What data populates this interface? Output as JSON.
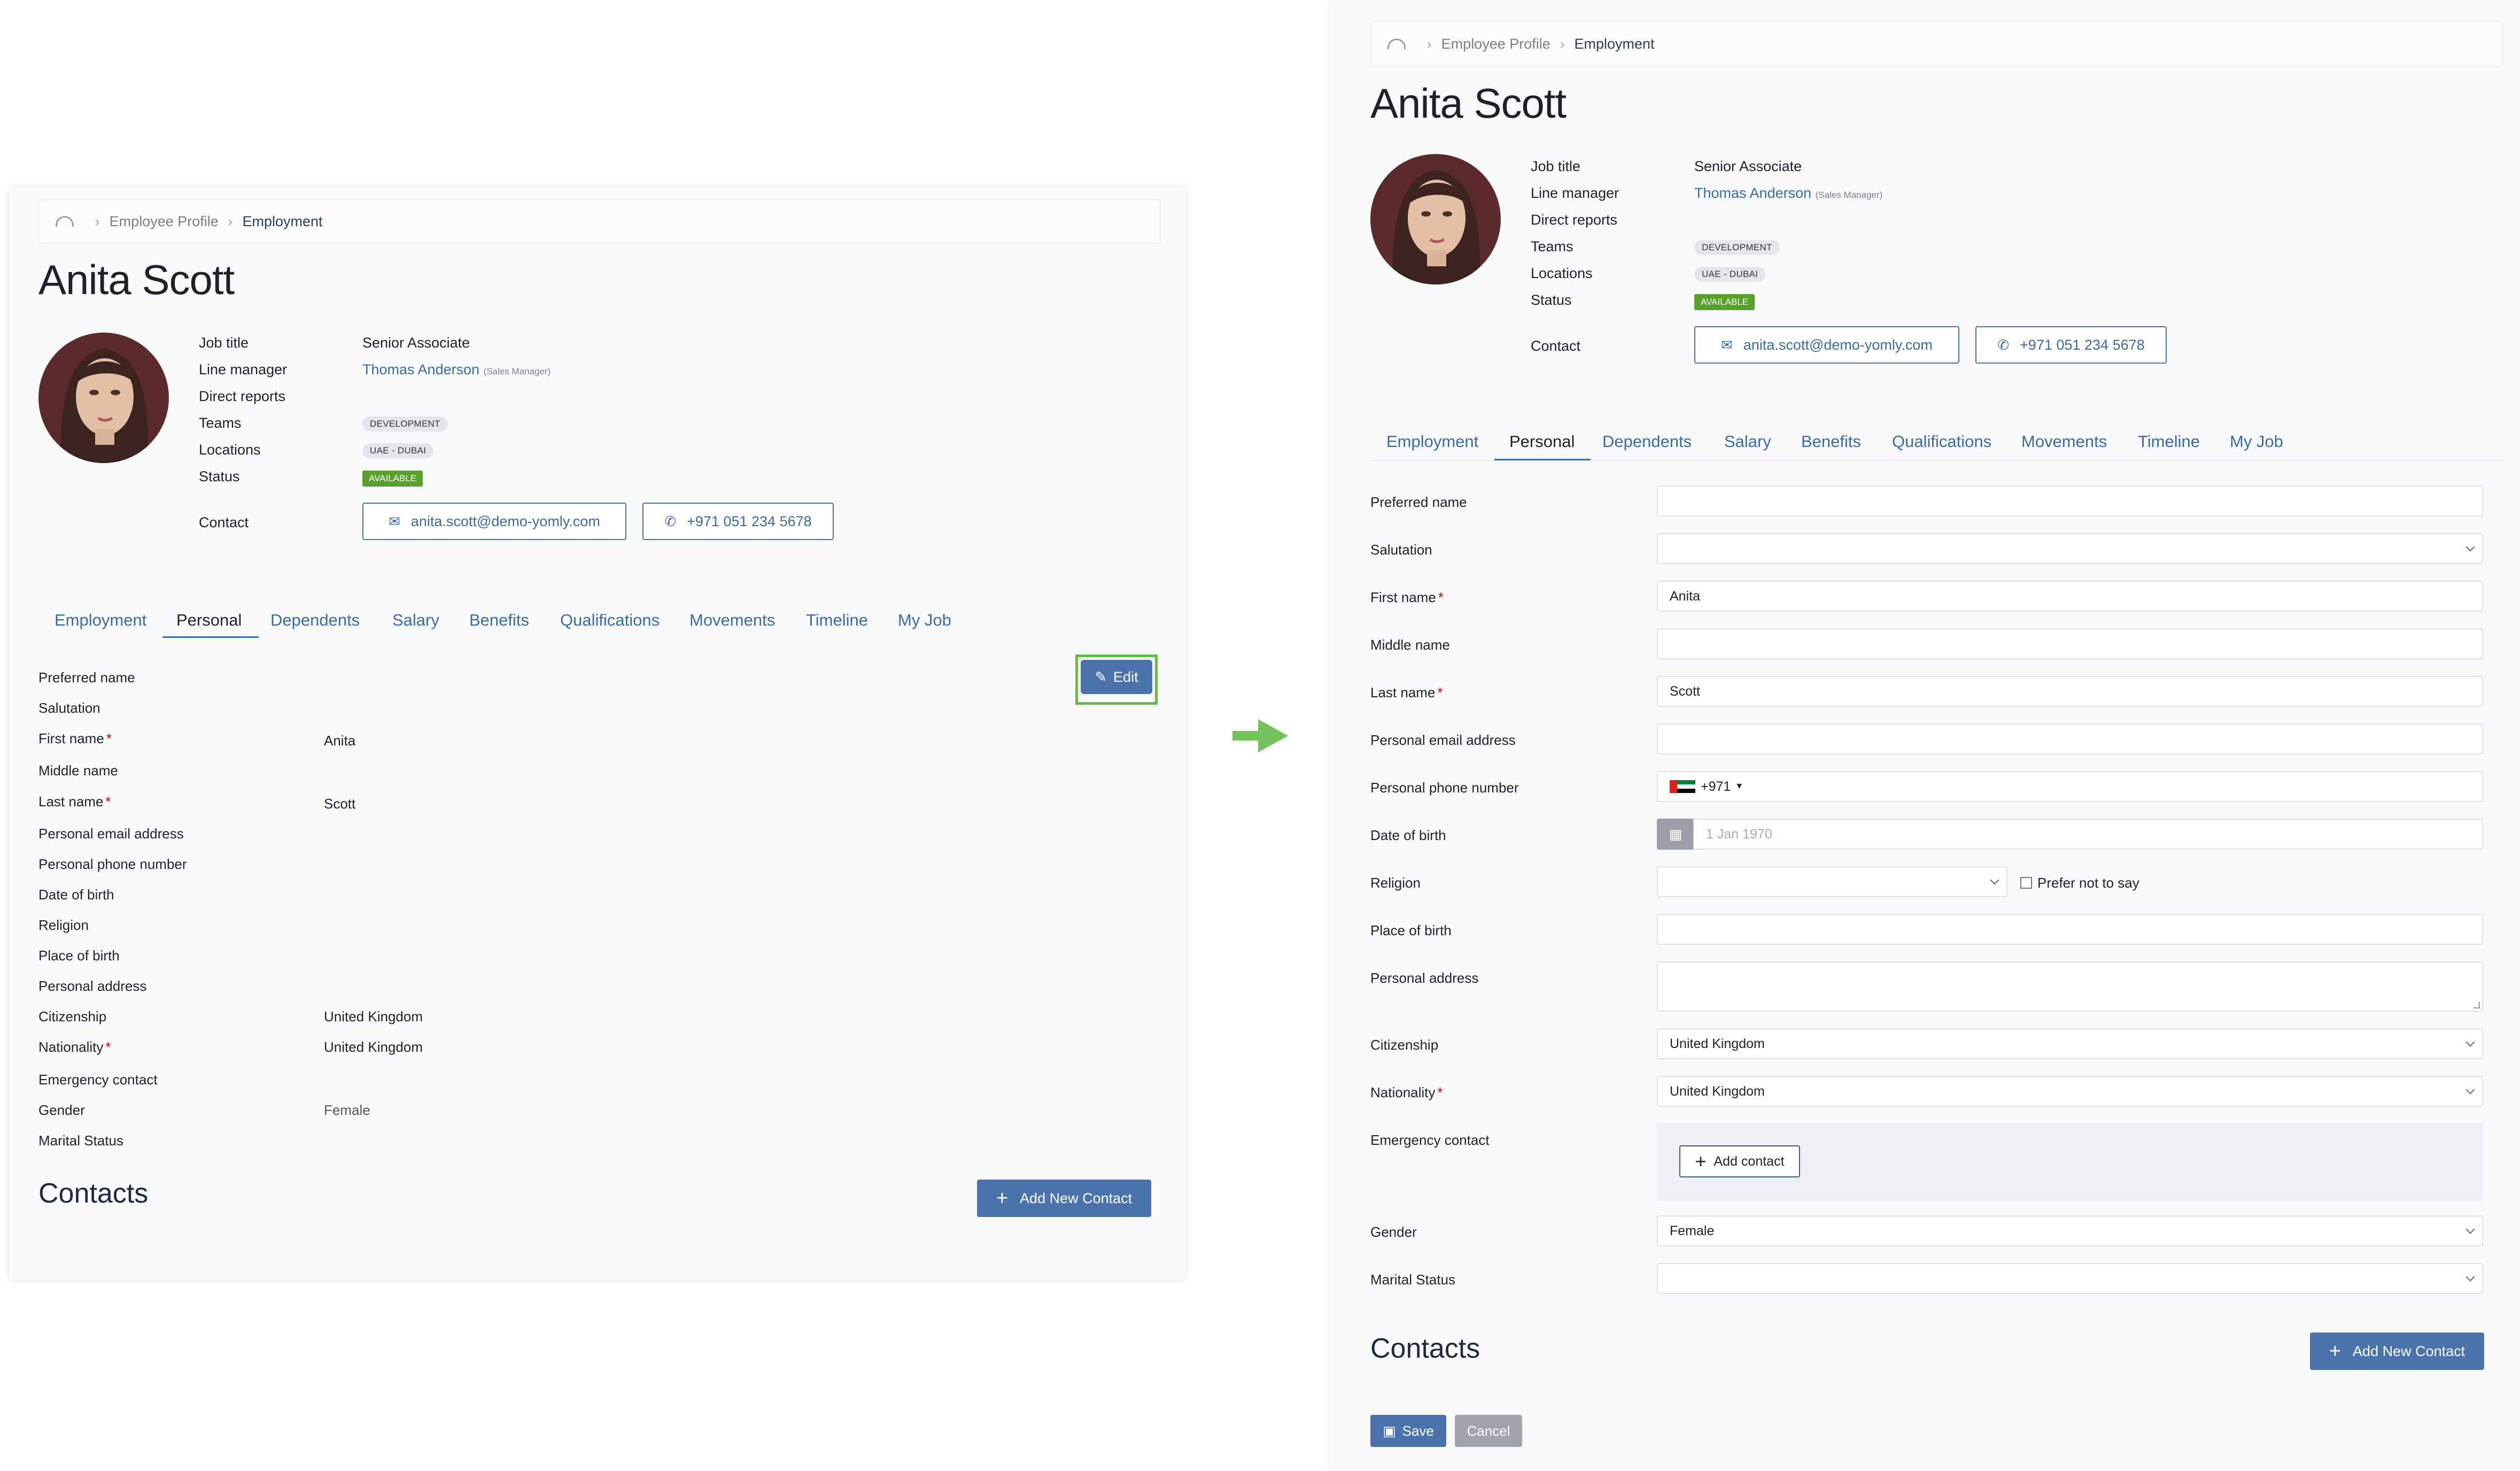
{
  "breadcrumb": {
    "parent": "Employee Profile",
    "current": "Employment"
  },
  "employee": {
    "name": "Anita Scott",
    "job_title_label": "Job title",
    "job_title": "Senior Associate",
    "line_manager_label": "Line manager",
    "line_manager": "Thomas Anderson",
    "line_manager_role": "(Sales Manager)",
    "direct_reports_label": "Direct reports",
    "teams_label": "Teams",
    "team": "DEVELOPMENT",
    "locations_label": "Locations",
    "location": "UAE - DUBAI",
    "status_label": "Status",
    "status": "AVAILABLE",
    "contact_label": "Contact",
    "email": "anita.scott@demo-yomly.com",
    "phone": "+971 051 234 5678"
  },
  "tabs": [
    "Employment",
    "Personal",
    "Dependents",
    "Salary",
    "Benefits",
    "Qualifications",
    "Movements",
    "Timeline",
    "My Job"
  ],
  "active_tab": "Personal",
  "fields": {
    "preferred_name": "Preferred name",
    "salutation": "Salutation",
    "first_name": "First name",
    "middle_name": "Middle name",
    "last_name": "Last name",
    "personal_email": "Personal email address",
    "personal_phone": "Personal phone number",
    "dob": "Date of birth",
    "religion": "Religion",
    "place_of_birth": "Place of birth",
    "personal_address": "Personal address",
    "citizenship": "Citizenship",
    "nationality": "Nationality",
    "emergency_contact": "Emergency contact",
    "gender": "Gender",
    "marital_status": "Marital Status"
  },
  "values": {
    "first_name": "Anita",
    "last_name": "Scott",
    "citizenship": "United Kingdom",
    "nationality": "United Kingdom",
    "gender": "Female",
    "phone_code": "+971",
    "dob_placeholder": "1 Jan 1970"
  },
  "actions": {
    "edit": "Edit",
    "contacts_title": "Contacts",
    "add_new_contact": "Add New Contact",
    "add_contact": "Add contact",
    "prefer_not_to_say": "Prefer not to say",
    "save": "Save",
    "cancel": "Cancel"
  },
  "colors": {
    "accent": "#4a73ad",
    "link": "#3b6aa8",
    "available": "#5aa02c",
    "highlight": "#66bb44"
  },
  "icons": [
    "home-icon",
    "chevron-right-icon",
    "envelope-icon",
    "phone-icon",
    "pencil-icon",
    "plus-icon",
    "calendar-icon",
    "chevron-down-icon",
    "save-icon",
    "arrow-right-icon",
    "uae-flag-icon"
  ]
}
